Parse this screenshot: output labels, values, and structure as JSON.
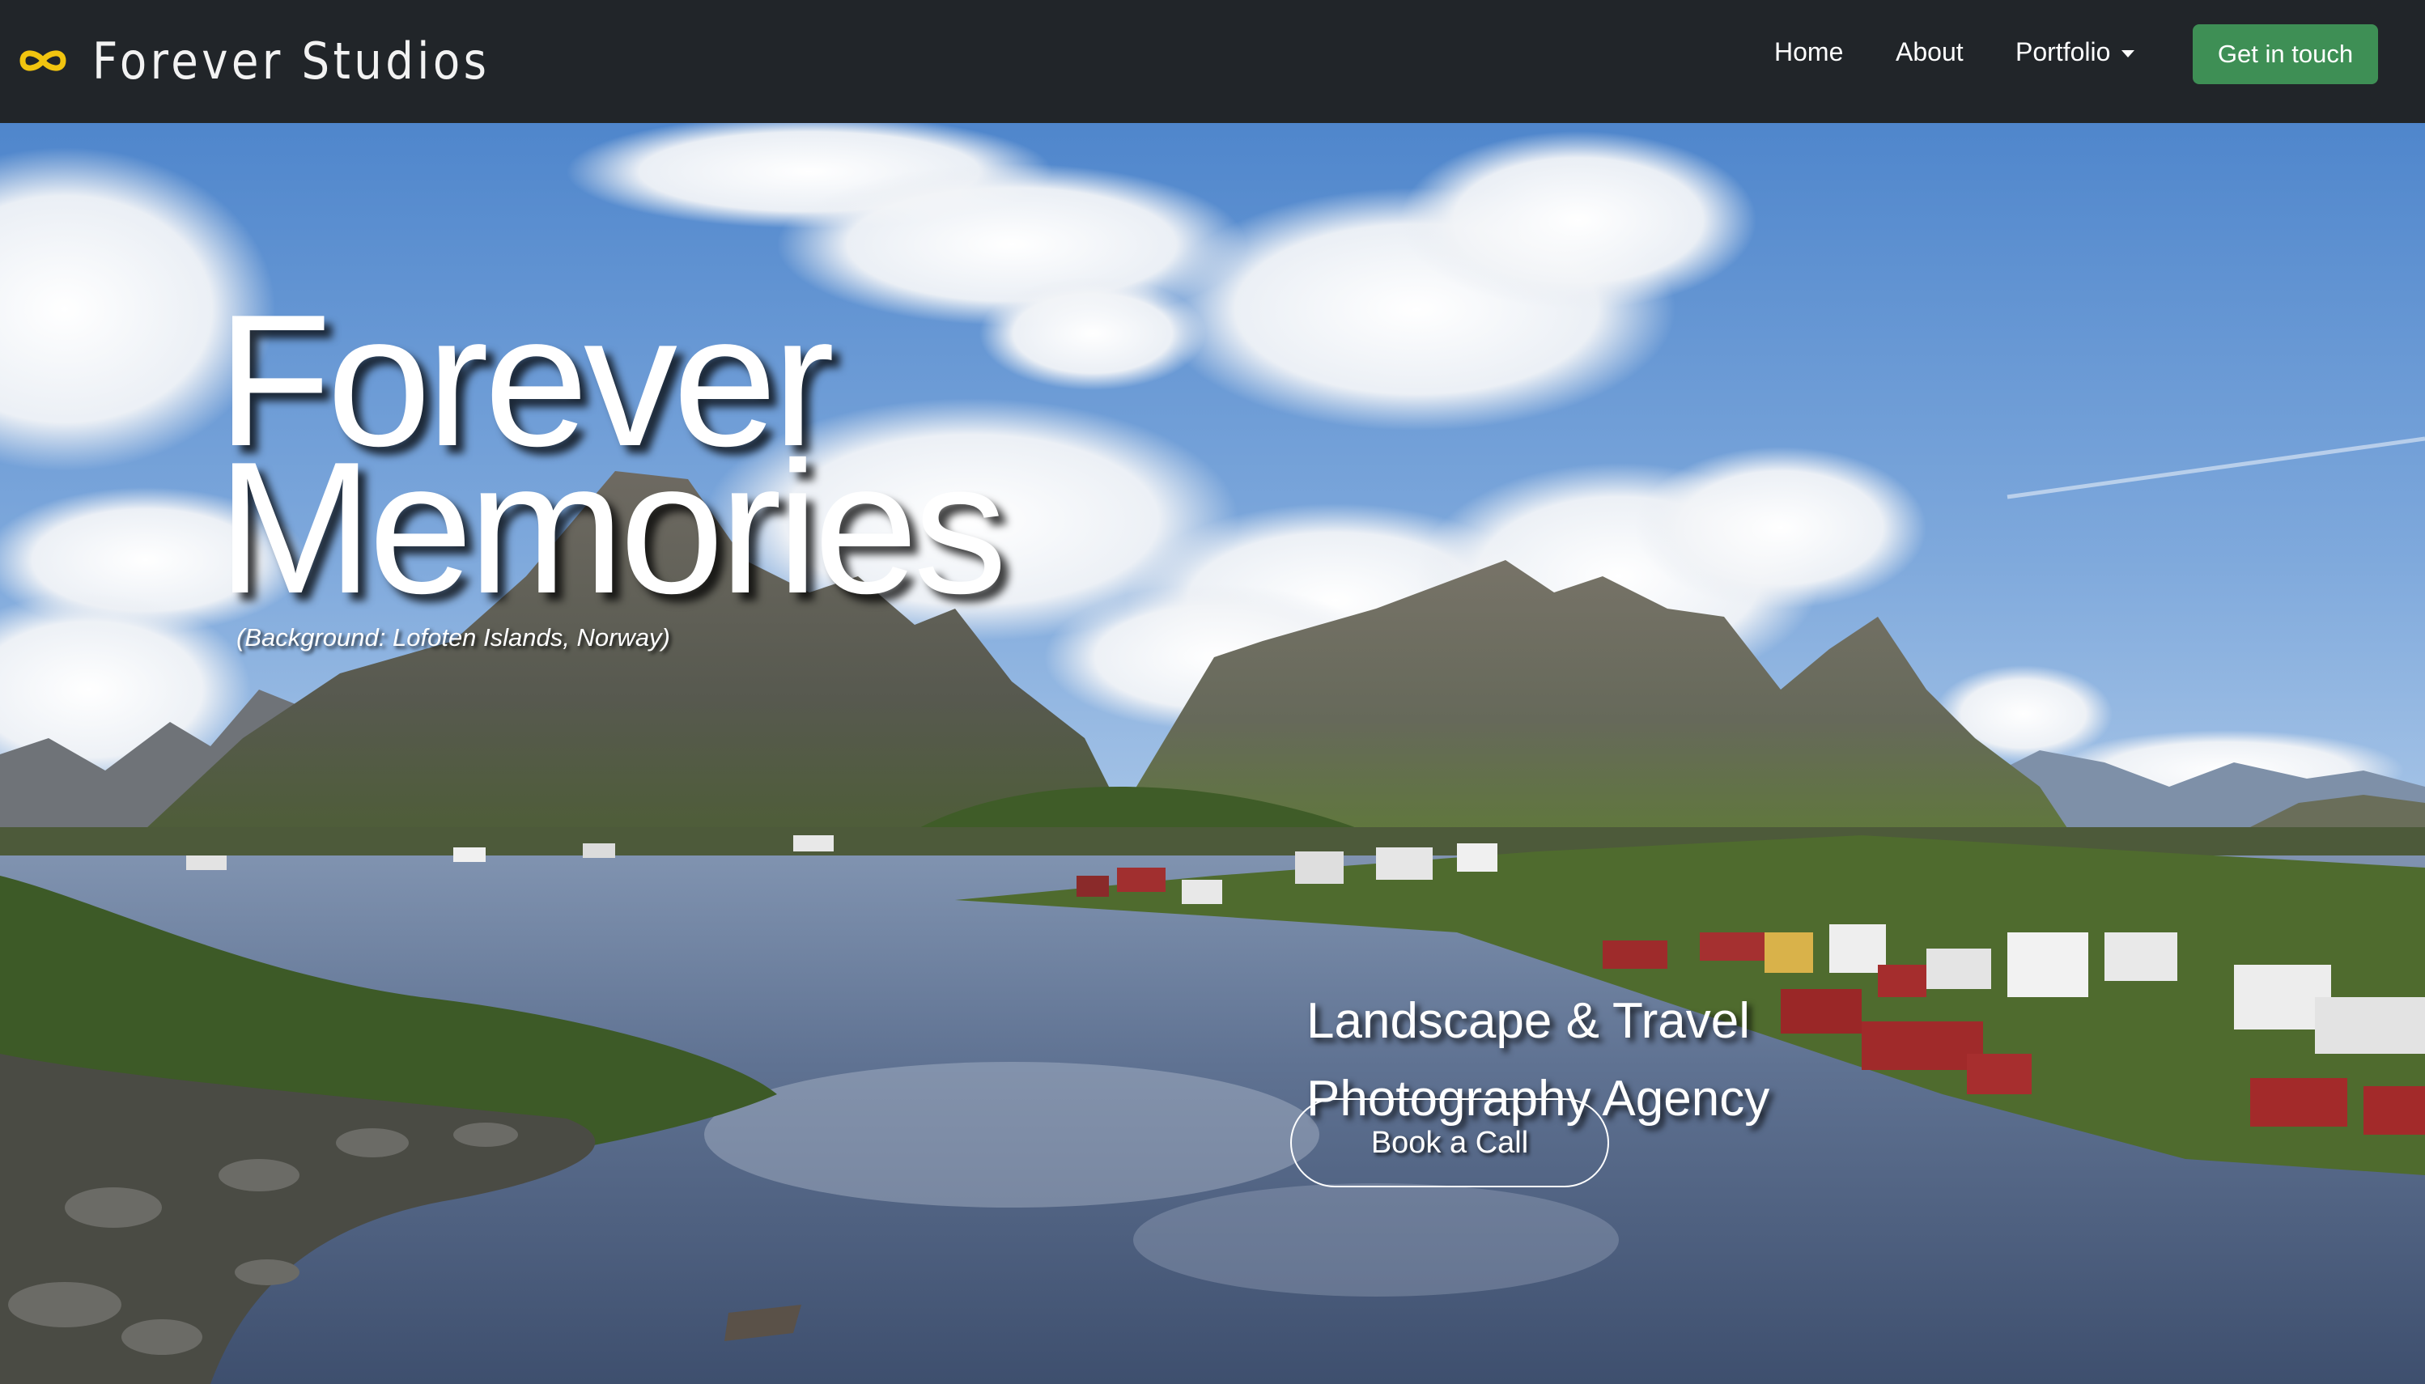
{
  "brand": {
    "name": "Forever Studios",
    "logo_icon": "infinity-icon",
    "logo_color": "#f1c40f"
  },
  "nav": {
    "home": "Home",
    "about": "About",
    "portfolio": "Portfolio",
    "cta": "Get in touch"
  },
  "hero": {
    "headline_line1": "Forever",
    "headline_line2": "Memories",
    "caption": "(Background: Lofoten Islands, Norway)",
    "tagline_line1": "Landscape & Travel",
    "tagline_line2": "Photography Agency",
    "button": "Book a Call"
  },
  "colors": {
    "navbar_bg": "#212529",
    "cta_bg": "#3e8f55",
    "sky": "#5a8fd0",
    "water": "#5d6f8e"
  }
}
